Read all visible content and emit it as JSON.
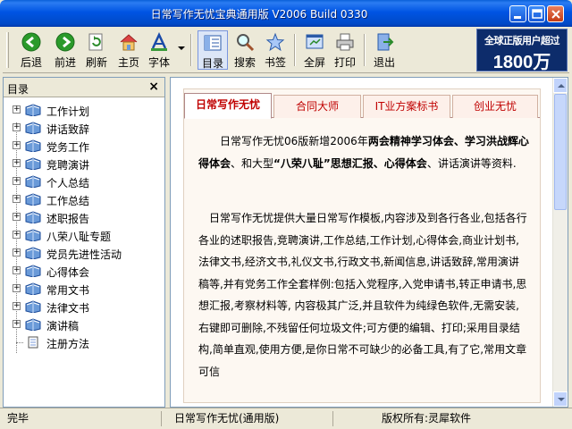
{
  "window": {
    "title": "日常写作无忧宝典通用版 V2006 Build 0330"
  },
  "toolbar": {
    "buttons": [
      {
        "label": "后退",
        "icon": "back-arrow-icon"
      },
      {
        "label": "前进",
        "icon": "forward-arrow-icon"
      },
      {
        "label": "刷新",
        "icon": "refresh-icon"
      },
      {
        "label": "主页",
        "icon": "home-icon"
      },
      {
        "label": "字体",
        "icon": "font-icon"
      },
      {
        "label": "目录",
        "icon": "toc-icon"
      },
      {
        "label": "搜索",
        "icon": "search-icon"
      },
      {
        "label": "书签",
        "icon": "bookmark-star-icon"
      },
      {
        "label": "全屏",
        "icon": "fullscreen-icon"
      },
      {
        "label": "打印",
        "icon": "printer-icon"
      },
      {
        "label": "退出",
        "icon": "exit-icon"
      }
    ],
    "banner": {
      "line1": "全球正版用户超过",
      "line2": "1800万"
    }
  },
  "sidebar": {
    "title": "目录",
    "close": "×",
    "items": [
      {
        "label": "工作计划",
        "expandable": true
      },
      {
        "label": "讲话致辞",
        "expandable": true
      },
      {
        "label": "党务工作",
        "expandable": true
      },
      {
        "label": "竞聘演讲",
        "expandable": true
      },
      {
        "label": "个人总结",
        "expandable": true
      },
      {
        "label": "工作总结",
        "expandable": true
      },
      {
        "label": "述职报告",
        "expandable": true
      },
      {
        "label": "八荣八耻专题",
        "expandable": true
      },
      {
        "label": "党员先进性活动",
        "expandable": true
      },
      {
        "label": "心得体会",
        "expandable": true
      },
      {
        "label": "常用文书",
        "expandable": true
      },
      {
        "label": "法律文书",
        "expandable": true
      },
      {
        "label": "演讲稿",
        "expandable": true
      },
      {
        "label": "注册方法",
        "expandable": false
      }
    ]
  },
  "content": {
    "tabs": [
      "日常写作无忧",
      "合同大师",
      "IT业方案标书",
      "创业无忧"
    ],
    "para1_parts": [
      "日常写作无忧06版新增2006年",
      "两会精神学习体会、学习洪战辉心得体会",
      "、和大型",
      "“八荣八耻”思想汇报、心得体会",
      "、讲话演讲等资料."
    ],
    "para2": "日常写作无忧提供大量日常写作模板,内容涉及到各行各业,包括各行各业的述职报告,竞聘演讲,工作总结,工作计划,心得体会,商业计划书,法律文书,经济文书,礼仪文书,行政文书,新闻信息,讲话致辞,常用演讲稿等,并有党务工作全套样例:包括入党程序,入党申请书,转正申请书,思想汇报,考察材料等, 内容极其广泛,并且软件为纯绿色软件,无需安装,右键即可删除,不残留任何垃圾文件;可方便的编辑、打印;采用目录结构,简单直观,使用方便,是你日常不可缺少的必备工具,有了它,常用文章可信"
  },
  "status": {
    "left": "完毕",
    "middle": "日常写作无忧(通用版)",
    "right": "版权所有:灵犀软件"
  }
}
